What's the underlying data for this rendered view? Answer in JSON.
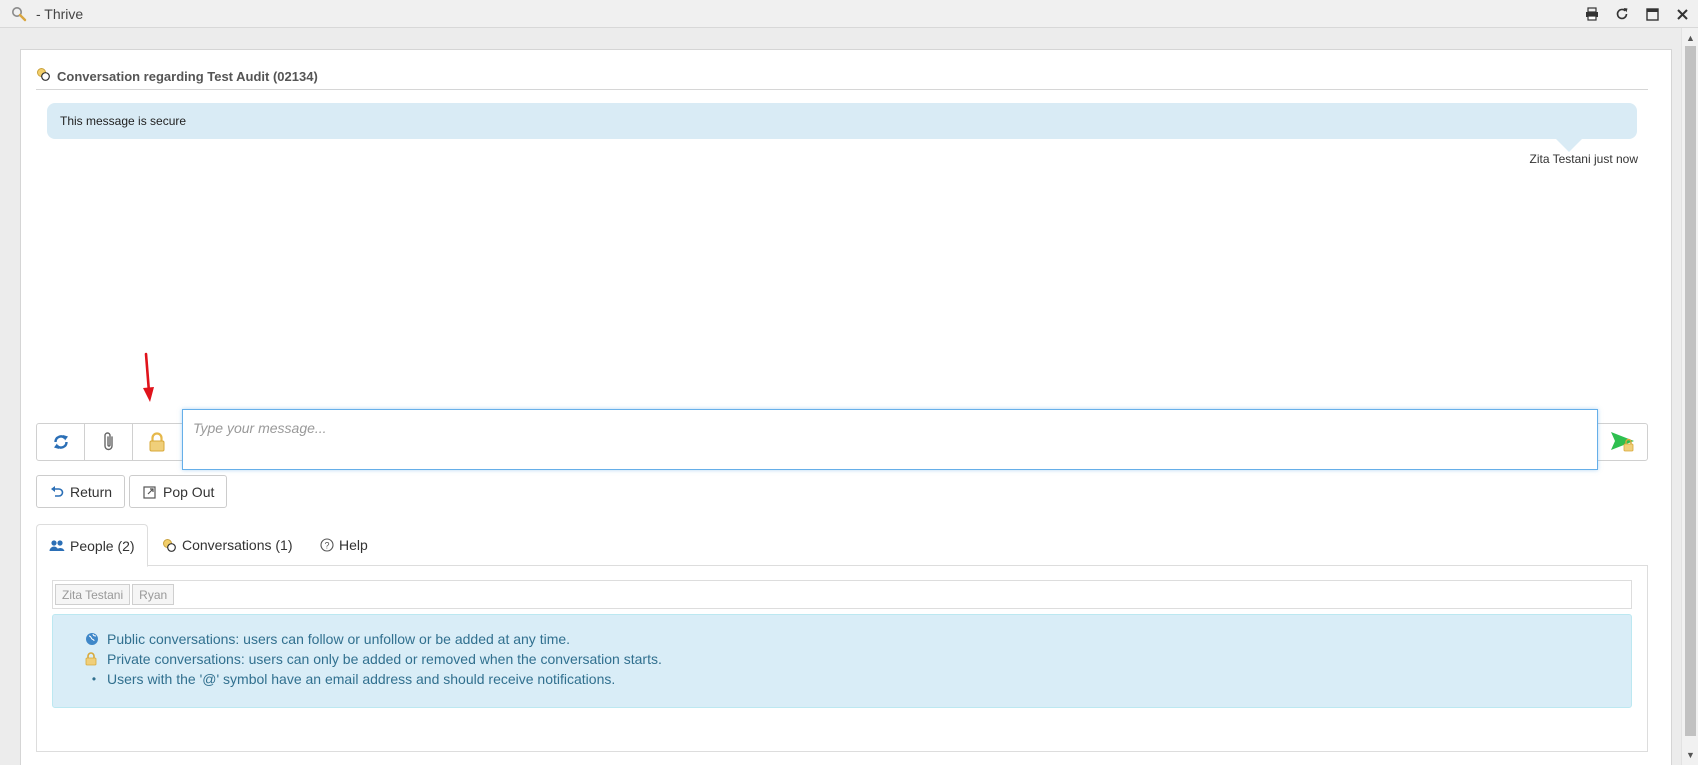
{
  "window": {
    "title": "- Thrive",
    "controls": [
      "print-icon",
      "refresh-icon",
      "maximize-icon",
      "close-icon"
    ]
  },
  "conversation": {
    "title": "Conversation regarding Test Audit (02134)",
    "message": {
      "text": "This message is secure",
      "meta": "Zita Testani just now"
    }
  },
  "compose": {
    "placeholder": "Type your message...",
    "buttons": [
      "refresh-icon",
      "paperclip-icon",
      "lock-icon",
      "send-icon"
    ]
  },
  "actions": {
    "return_label": "Return",
    "popout_label": "Pop Out"
  },
  "tabs": [
    {
      "label": "People (2)",
      "active": true
    },
    {
      "label": "Conversations (1)",
      "active": false
    },
    {
      "label": "Help",
      "active": false
    }
  ],
  "people": [
    "Zita Testani",
    "Ryan"
  ],
  "info": {
    "public": "Public conversations: users can follow or unfollow or be added at any time.",
    "private": "Private conversations: users can only be added or removed when the conversation starts.",
    "email": "Users with the '@' symbol have an email address and should receive notifications."
  },
  "colors": {
    "bubble": "#d9ebf5",
    "info_bg": "#d9edf7",
    "info_text": "#31708f",
    "accent_blue": "#66afe9",
    "send_green": "#2ebf4f",
    "lock_gold": "#e6b84b",
    "arrow_red": "#e0131b"
  }
}
